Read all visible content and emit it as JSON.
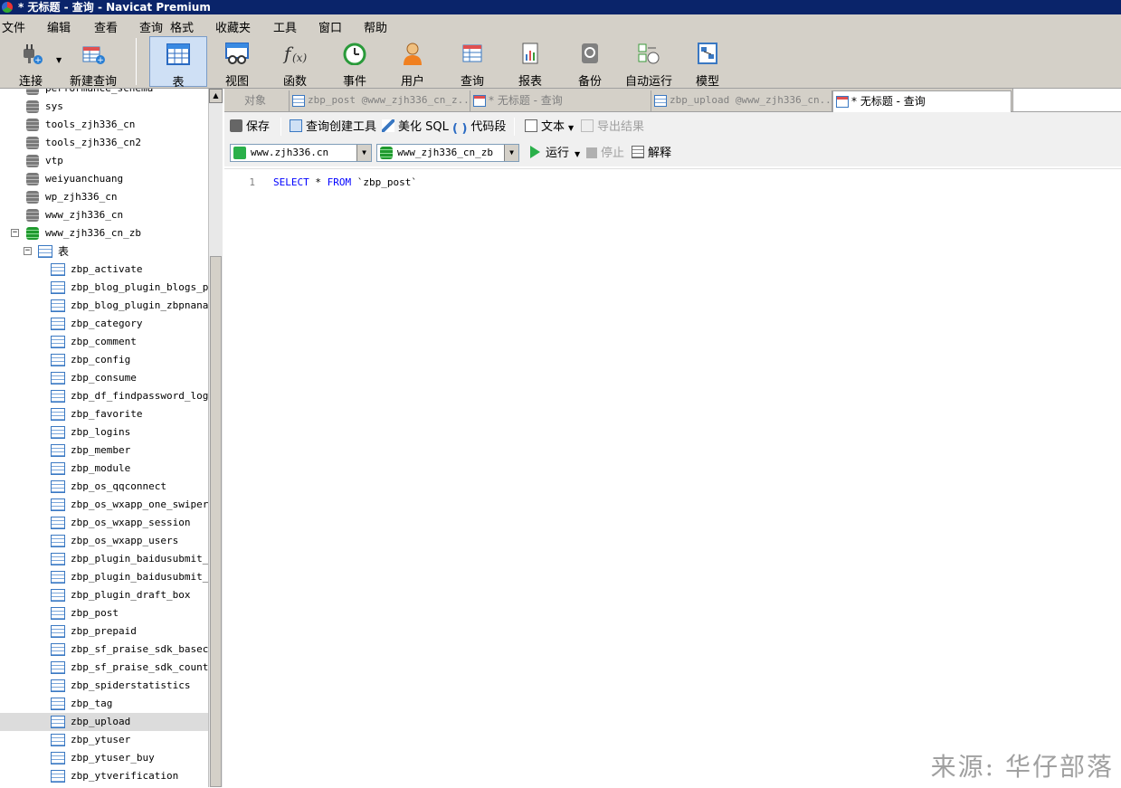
{
  "window": {
    "title": "* 无标题 - 查询 - Navicat Premium"
  },
  "menu": [
    "文件",
    "编辑",
    "查看",
    "查询",
    "格式",
    "收藏夹",
    "工具",
    "窗口",
    "帮助"
  ],
  "toolbar": {
    "connect": "连接",
    "new_query": "新建查询",
    "table": "表",
    "view": "视图",
    "function": "函数",
    "event": "事件",
    "user": "用户",
    "query": "查询",
    "report": "报表",
    "backup": "备份",
    "automation": "自动运行",
    "model": "模型"
  },
  "sidebar": {
    "databases": [
      "performance_schema",
      "sys",
      "tools_zjh336_cn",
      "tools_zjh336_cn2",
      "vtp",
      "weiyuanchuang",
      "wp_zjh336_cn",
      "www_zjh336_cn",
      "www_zjh336_cn_zb"
    ],
    "tables_node": "表",
    "tables": [
      "zbp_activate",
      "zbp_blog_plugin_blogs_pri",
      "zbp_blog_plugin_zbpnana_pr",
      "zbp_category",
      "zbp_comment",
      "zbp_config",
      "zbp_consume",
      "zbp_df_findpassword_log",
      "zbp_favorite",
      "zbp_logins",
      "zbp_member",
      "zbp_module",
      "zbp_os_qqconnect",
      "zbp_os_wxapp_one_swiper",
      "zbp_os_wxapp_session",
      "zbp_os_wxapp_users",
      "zbp_plugin_baidusubmit_si",
      "zbp_plugin_baidusubmit_ur",
      "zbp_plugin_draft_box",
      "zbp_post",
      "zbp_prepaid",
      "zbp_sf_praise_sdk_basecou",
      "zbp_sf_praise_sdk_count",
      "zbp_spiderstatistics",
      "zbp_tag",
      "zbp_upload",
      "zbp_ytuser",
      "zbp_ytuser_buy",
      "zbp_ytverification"
    ],
    "selected_table": "zbp_upload"
  },
  "tabs": [
    "对象",
    "zbp_post @www_zjh336_cn_z...",
    "* 无标题 - 查询",
    "zbp_upload @www_zjh336_cn...",
    "* 无标题 - 查询"
  ],
  "query_toolbar": {
    "save": "保存",
    "builder": "查询创建工具",
    "beautify": "美化 SQL",
    "snippet": "代码段",
    "text": "文本",
    "export": "导出结果",
    "run": "运行",
    "stop": "停止",
    "explain": "解释",
    "connection": "www.zjh336.cn",
    "database": "www_zjh336_cn_zb"
  },
  "editor": {
    "line_number": "1",
    "kw_select": "SELECT",
    "star": " * ",
    "kw_from": "FROM",
    "table_ref": " `zbp_post`"
  },
  "watermark": "来源: 华仔部落",
  "colors": {
    "title_bar": "#0a246a",
    "chrome": "#d4d0c8",
    "keyword": "#0000ff",
    "selection": "#dcdcdc"
  }
}
